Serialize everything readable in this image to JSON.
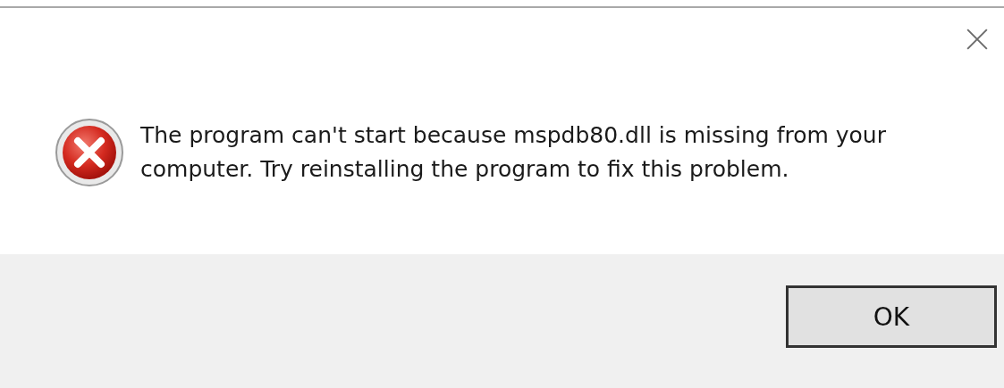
{
  "dialog": {
    "message": "The program can't start because mspdb80.dll is missing from your computer. Try reinstalling the program to fix this problem.",
    "buttons": [
      {
        "label": "OK",
        "default": true
      }
    ]
  }
}
